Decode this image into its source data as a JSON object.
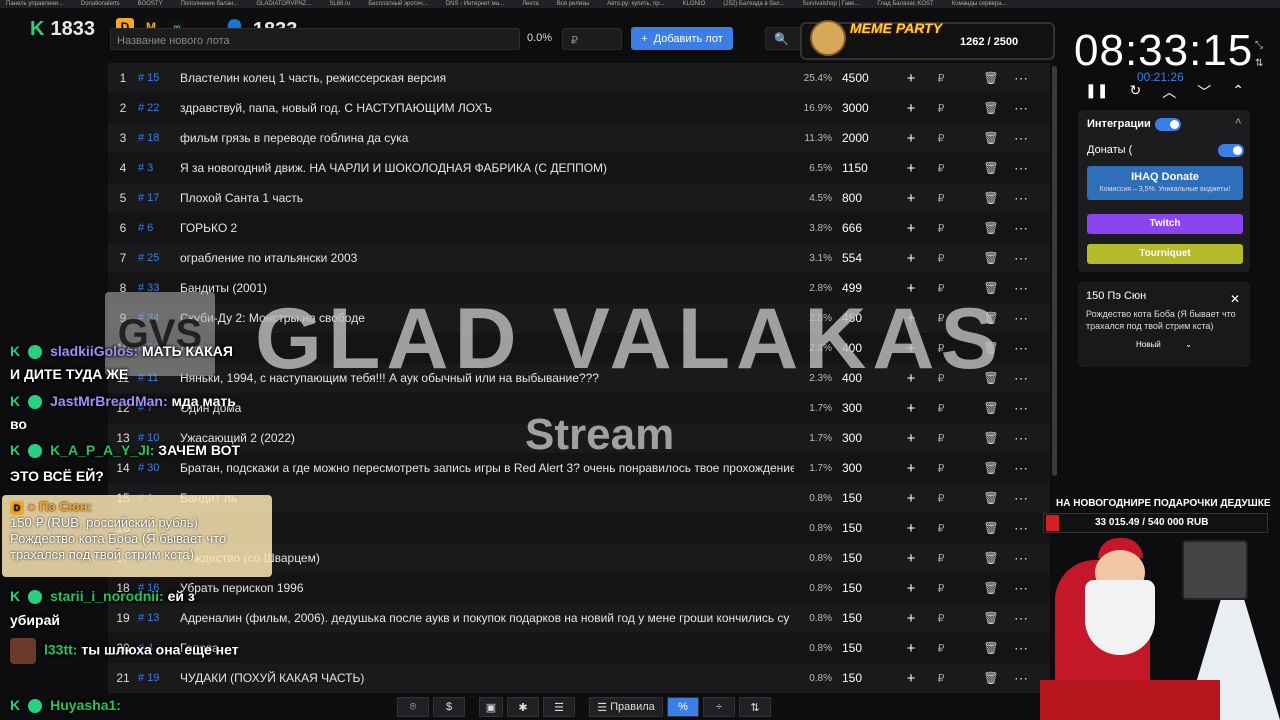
{
  "browser_tabs": [
    "Панель управлени...",
    "Donationalerts",
    "BOOSTY",
    "Пополнение балан...",
    "GLADIATORVPNZ...",
    "SL88.ru",
    "Бесплатный эротич...",
    "DNS - Интернет ма...",
    "Лента",
    "Все релизы",
    "Авто.ру: купить, пр...",
    "KLONIO",
    "(252) Балхада в бал...",
    "Survivalshop | Гаве...",
    "Глад Балахас KOST",
    "Команды сервера..."
  ],
  "header": {
    "left_count": "1833",
    "right_count": "1833",
    "lot_placeholder": "Название нового лота",
    "percent": "0.0%",
    "price_placeholder": "₽",
    "add_button": "Добавить лот",
    "search_placeholder": "П"
  },
  "meme_party": {
    "title": "MEME PARTY",
    "count": "1262 / 2500"
  },
  "table": {
    "rows": [
      {
        "n": "1",
        "id": "# 15",
        "name": "Властелин колец 1 часть, режиссерская версия",
        "pct": "25.4%",
        "amt": "4500"
      },
      {
        "n": "2",
        "id": "# 22",
        "name": "здравствуй, папа, новый год. С НАСТУПАЮЩИМ ЛОХЪ",
        "pct": "16.9%",
        "amt": "3000"
      },
      {
        "n": "3",
        "id": "# 18",
        "name": "фильм грязь в переводе гоблина да сука",
        "pct": "11.3%",
        "amt": "2000"
      },
      {
        "n": "4",
        "id": "# 3",
        "name": "Я за новогодний движ. НА ЧАРЛИ И ШОКОЛОДНАЯ ФАБРИКА (С ДЕППОМ)",
        "pct": "6.5%",
        "amt": "1150"
      },
      {
        "n": "5",
        "id": "# 17",
        "name": "Плохой Санта 1 часть",
        "pct": "4.5%",
        "amt": "800"
      },
      {
        "n": "6",
        "id": "# 6",
        "name": "ГОРЬКО 2",
        "pct": "3.8%",
        "amt": "666"
      },
      {
        "n": "7",
        "id": "# 25",
        "name": "ограбление по итальянски 2003",
        "pct": "3.1%",
        "amt": "554"
      },
      {
        "n": "8",
        "id": "# 33",
        "name": "Бандиты (2001)",
        "pct": "2.8%",
        "amt": "499"
      },
      {
        "n": "9",
        "id": "# 34",
        "name": "Скуби-Ду 2: Монстры на свободе",
        "pct": "2.5%",
        "amt": "450"
      },
      {
        "n": "10",
        "id": "# 20",
        "name": "Люди",
        "pct": "2.3%",
        "amt": "400"
      },
      {
        "n": "11",
        "id": "# 11",
        "name": "Няньки, 1994, с наступающим тебя!!! А аук обычный или на выбывание???",
        "pct": "2.3%",
        "amt": "400"
      },
      {
        "n": "12",
        "id": "# 7",
        "name": "Один дома",
        "pct": "1.7%",
        "amt": "300"
      },
      {
        "n": "13",
        "id": "# 10",
        "name": "Ужасающий 2 (2022)",
        "pct": "1.7%",
        "amt": "300"
      },
      {
        "n": "14",
        "id": "# 30",
        "name": "Братан, подскажи а где можно пересмотреть запись игры в Red Alert 3? очень понравилось твое прохождение",
        "pct": "1.7%",
        "amt": "300"
      },
      {
        "n": "15",
        "id": "# 1",
        "name": "Бандит ль",
        "pct": "0.8%",
        "amt": "150"
      },
      {
        "n": "16",
        "id": "# 2",
        "name": "",
        "pct": "0.8%",
        "amt": "150"
      },
      {
        "n": "17",
        "id": "# 12",
        "name": "Рождество (со Шварцем)",
        "pct": "0.8%",
        "amt": "150"
      },
      {
        "n": "18",
        "id": "# 16",
        "name": "Убрать перископ 1996",
        "pct": "0.8%",
        "amt": "150"
      },
      {
        "n": "19",
        "id": "# 13",
        "name": "Адреналин (фильм, 2006). дедушька после аукв и покупок подарков на новий год у мене гроши кончились су",
        "pct": "0.8%",
        "amt": "150"
      },
      {
        "n": "20",
        "id": "# 4",
        "name": "Голова",
        "pct": "0.8%",
        "amt": "150"
      },
      {
        "n": "21",
        "id": "# 19",
        "name": "ЧУДАКИ (ПОХУЙ КАКАЯ ЧАСТЬ)",
        "pct": "0.8%",
        "amt": "150"
      }
    ],
    "plus": "+",
    "rub": "₽",
    "del": "🗑",
    "more": "⋯"
  },
  "watermark": {
    "title": "GLAD VALAKAS",
    "sub": "Stream"
  },
  "chat": [
    {
      "user": "sladkiiGolos:",
      "msg": "МАТЬ КАКАЯ",
      "cont": "И ДИТЕ ТУДА ЖЕ"
    },
    {
      "user": "JastMrBreadMan:",
      "msg": "мда мать",
      "cont": "во"
    },
    {
      "user": "K_A_P_A_Y_JI:",
      "msg": "ЗАЧЕМ ВОТ",
      "cont": "ЭТО ВСЁ ЕЙ?"
    },
    {
      "user": "starii_i_norodnii:",
      "msg": "ей з",
      "cont": "убирай"
    },
    {
      "user": "l33tt:",
      "msg": "ты шлюха она еще нет"
    },
    {
      "user": "Huyasha1:",
      "msg": ""
    }
  ],
  "donation_card": {
    "name": "Пэ Сюн:",
    "amount": "150 ₽ (RUB, российский рубль)",
    "text": "Рождество кота Боба (Я бывает что трахался под твой стрим кста)"
  },
  "right_panel": {
    "clock": "08:33:15",
    "sub_clock": "00:21:26",
    "integrations": "Интеграции",
    "donations": "Донаты (",
    "ihaq": "IHAQ Donate",
    "ihaq_sub": "Комиссия – 3,5%. Уникальные виджеты!",
    "twitch": "Twitch",
    "tourniquet": "Tourniquet",
    "notif_title": "150 Пэ Сюн",
    "notif_text": "Рождество кота Боба (Я бывает что трахался под твой стрим кста)",
    "notif_select": "Новый",
    "goal_title": "НА НОВОГОДНИРЕ ПОДАРОЧКИ ДЕДУШКЕ",
    "goal_value": "33 015.49 / 540 000 RUB",
    "goal_fraction": 0.061
  },
  "toolbar": {
    "rules": "Правила"
  },
  "colors": {
    "accent": "#3a7ee6",
    "chat_k": "#27d17f",
    "twitch": "#8a45f0"
  }
}
